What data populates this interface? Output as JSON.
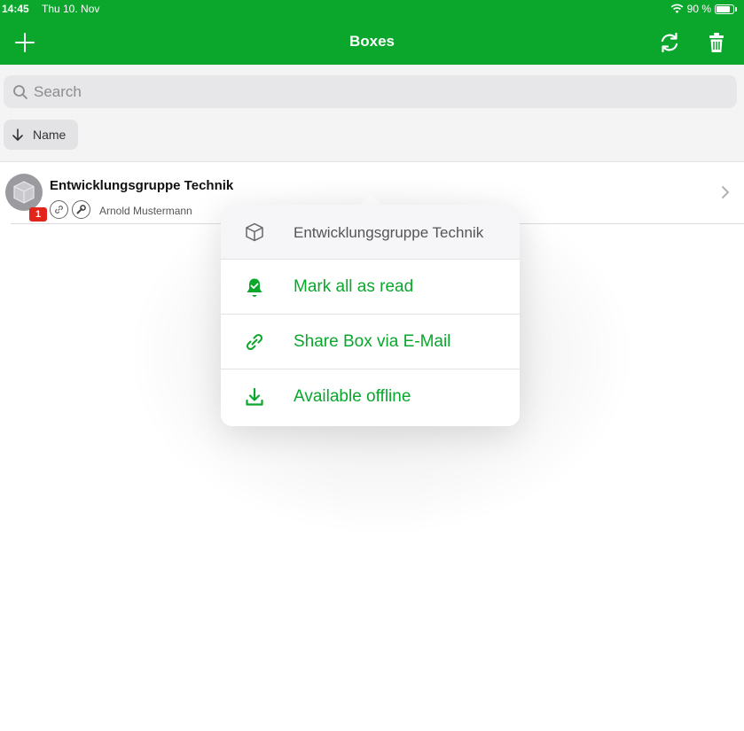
{
  "status_bar": {
    "time": "14:45",
    "date": "Thu 10. Nov",
    "battery": "90 %",
    "battery_level": 0.9
  },
  "nav": {
    "title": "Boxes",
    "add_icon": "plus-icon",
    "sync_icon": "sync-icon",
    "trash_icon": "trash-icon"
  },
  "search": {
    "placeholder": "Search"
  },
  "sort": {
    "label": "Name",
    "direction_icon": "arrow-down-icon"
  },
  "list": {
    "items": [
      {
        "title": "Entwicklungsgruppe Technik",
        "author": "Arnold Mustermann",
        "badge": "1"
      }
    ]
  },
  "popover": {
    "header": "Entwicklungsgruppe Technik",
    "items": [
      {
        "label": "Mark all as read",
        "icon": "bell-check-icon"
      },
      {
        "label": "Share Box via E-Mail",
        "icon": "link-icon"
      },
      {
        "label": "Available offline",
        "icon": "download-icon"
      }
    ]
  },
  "colors": {
    "brand_green": "#0aa72c",
    "badge_red": "#e3241b"
  }
}
